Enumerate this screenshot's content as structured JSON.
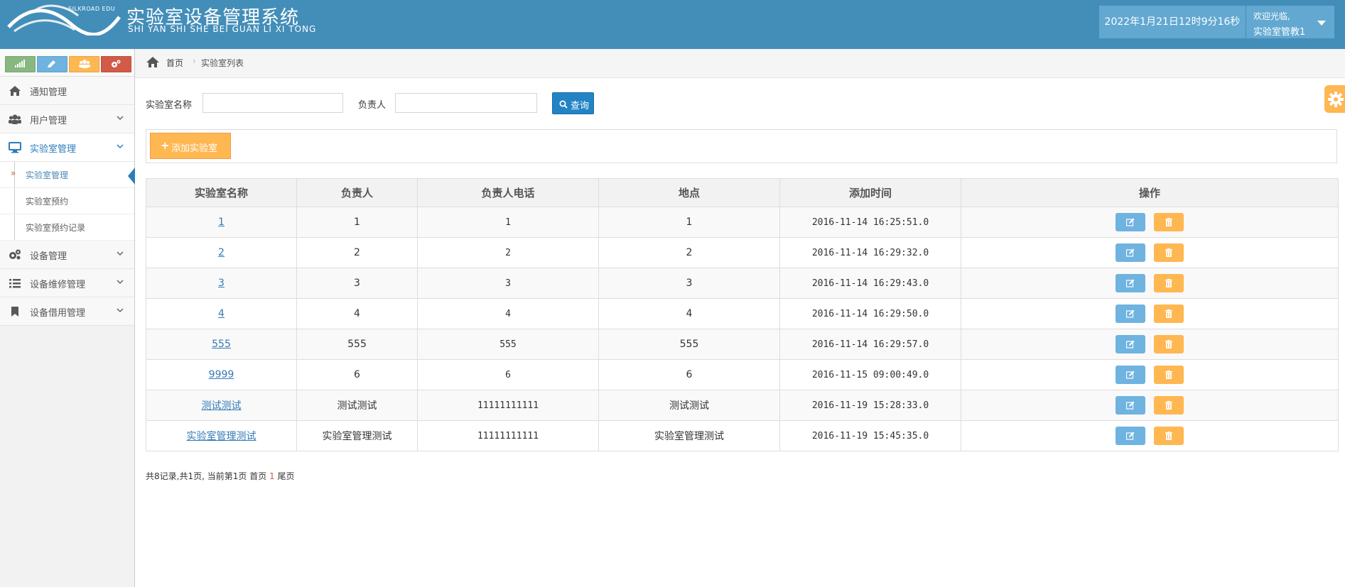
{
  "header": {
    "logo_edu": "SILKROAD EDU",
    "title": "实验室设备管理系统",
    "subtitle": "SHI YAN SHI SHE BEI GUAN LI XI TONG",
    "clock": "2022年1月21日12时9分16秒",
    "welcome_line1": "欢迎光临,",
    "welcome_line2": "实验室管教1"
  },
  "sidebar": {
    "shortcut_colors": [
      "#87b87f",
      "#6fb3e0",
      "#ffb752",
      "#d15b47"
    ],
    "items": [
      {
        "label": "通知管理",
        "icon": "home-icon"
      },
      {
        "label": "用户管理",
        "icon": "users-icon"
      },
      {
        "label": "实验室管理",
        "icon": "desktop-icon"
      },
      {
        "label": "设备管理",
        "icon": "cogs-icon"
      },
      {
        "label": "设备维修管理",
        "icon": "list-icon"
      },
      {
        "label": "设备借用管理",
        "icon": "bookmark-icon"
      }
    ],
    "sub_items": [
      {
        "label": "实验室管理"
      },
      {
        "label": "实验室预约"
      },
      {
        "label": "实验室预约记录"
      }
    ]
  },
  "breadcrumb": {
    "home": "首页",
    "current": "实验室列表"
  },
  "search": {
    "name_label": "实验室名称",
    "name_value": "",
    "owner_label": "负责人",
    "owner_value": "",
    "button": "查询"
  },
  "toolbar": {
    "add_label": "添加实验室"
  },
  "table": {
    "columns": [
      "实验室名称",
      "负责人",
      "负责人电话",
      "地点",
      "添加时间",
      "操作"
    ],
    "rows": [
      {
        "name": "1",
        "owner": "1",
        "phone": "1",
        "location": "1",
        "time": "2016-11-14 16:25:51.0"
      },
      {
        "name": "2",
        "owner": "2",
        "phone": "2",
        "location": "2",
        "time": "2016-11-14 16:29:32.0"
      },
      {
        "name": "3",
        "owner": "3",
        "phone": "3",
        "location": "3",
        "time": "2016-11-14 16:29:43.0"
      },
      {
        "name": "4",
        "owner": "4",
        "phone": "4",
        "location": "4",
        "time": "2016-11-14 16:29:50.0"
      },
      {
        "name": "555",
        "owner": "555",
        "phone": "555",
        "location": "555",
        "time": "2016-11-14 16:29:57.0"
      },
      {
        "name": "9999",
        "owner": "6",
        "phone": "6",
        "location": "6",
        "time": "2016-11-15 09:00:49.0"
      },
      {
        "name": "测试测试",
        "owner": "测试测试",
        "phone": "11111111111",
        "location": "测试测试",
        "time": "2016-11-19 15:28:33.0"
      },
      {
        "name": "实验室管理测试",
        "owner": "实验室管理测试",
        "phone": "11111111111",
        "location": "实验室管理测试",
        "time": "2016-11-19 15:45:35.0"
      }
    ]
  },
  "pager": {
    "summary": "共8记录,共1页, 当前第1页",
    "first": "首页",
    "current_page": "1",
    "last": "尾页"
  }
}
